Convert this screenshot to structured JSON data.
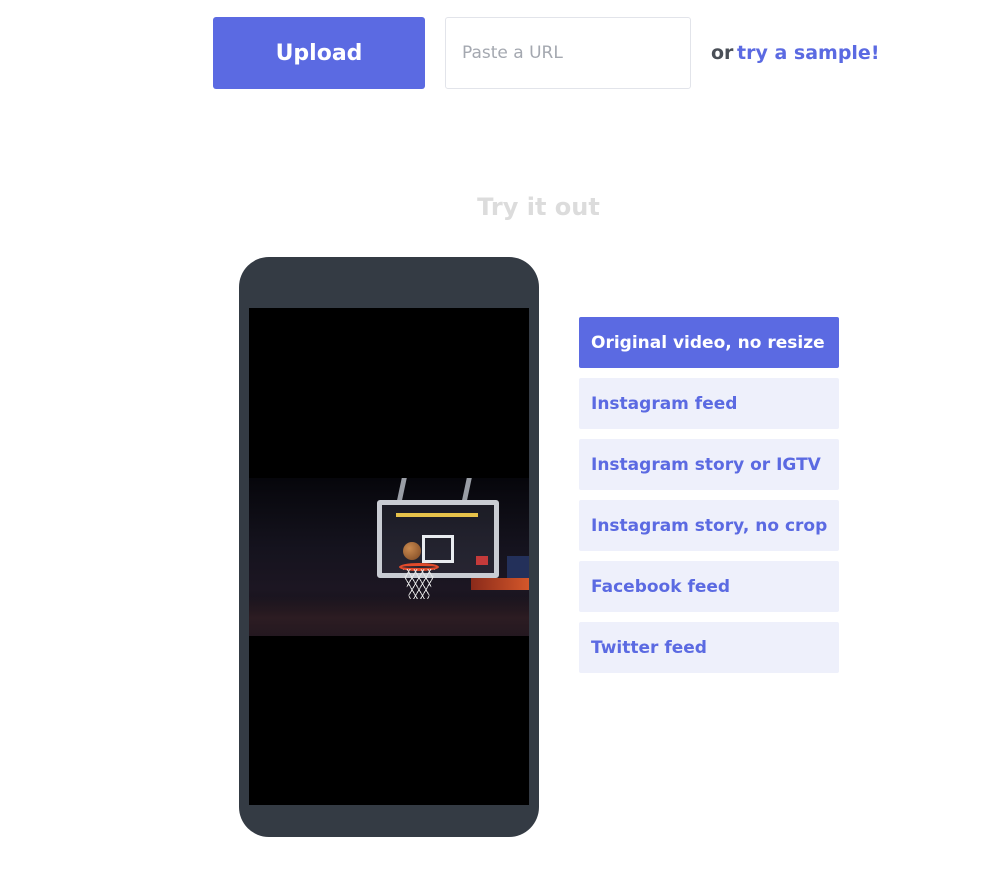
{
  "header": {
    "upload_label": "Upload",
    "url_placeholder": "Paste a URL",
    "or_text": "or",
    "sample_link": "try a sample!"
  },
  "section": {
    "heading": "Try it out"
  },
  "preview": {
    "selected_option_index": 0
  },
  "options": [
    {
      "label": "Original video, no resize",
      "active": true
    },
    {
      "label": "Instagram feed",
      "active": false
    },
    {
      "label": "Instagram story or IGTV",
      "active": false
    },
    {
      "label": "Instagram story, no crop",
      "active": false
    },
    {
      "label": "Facebook feed",
      "active": false
    },
    {
      "label": "Twitter feed",
      "active": false
    }
  ],
  "colors": {
    "accent": "#5b6ae2",
    "option_bg": "#eef0fb",
    "phone_body": "#343b44",
    "heading": "#dcdcdc",
    "or_text": "#4a4f57"
  }
}
